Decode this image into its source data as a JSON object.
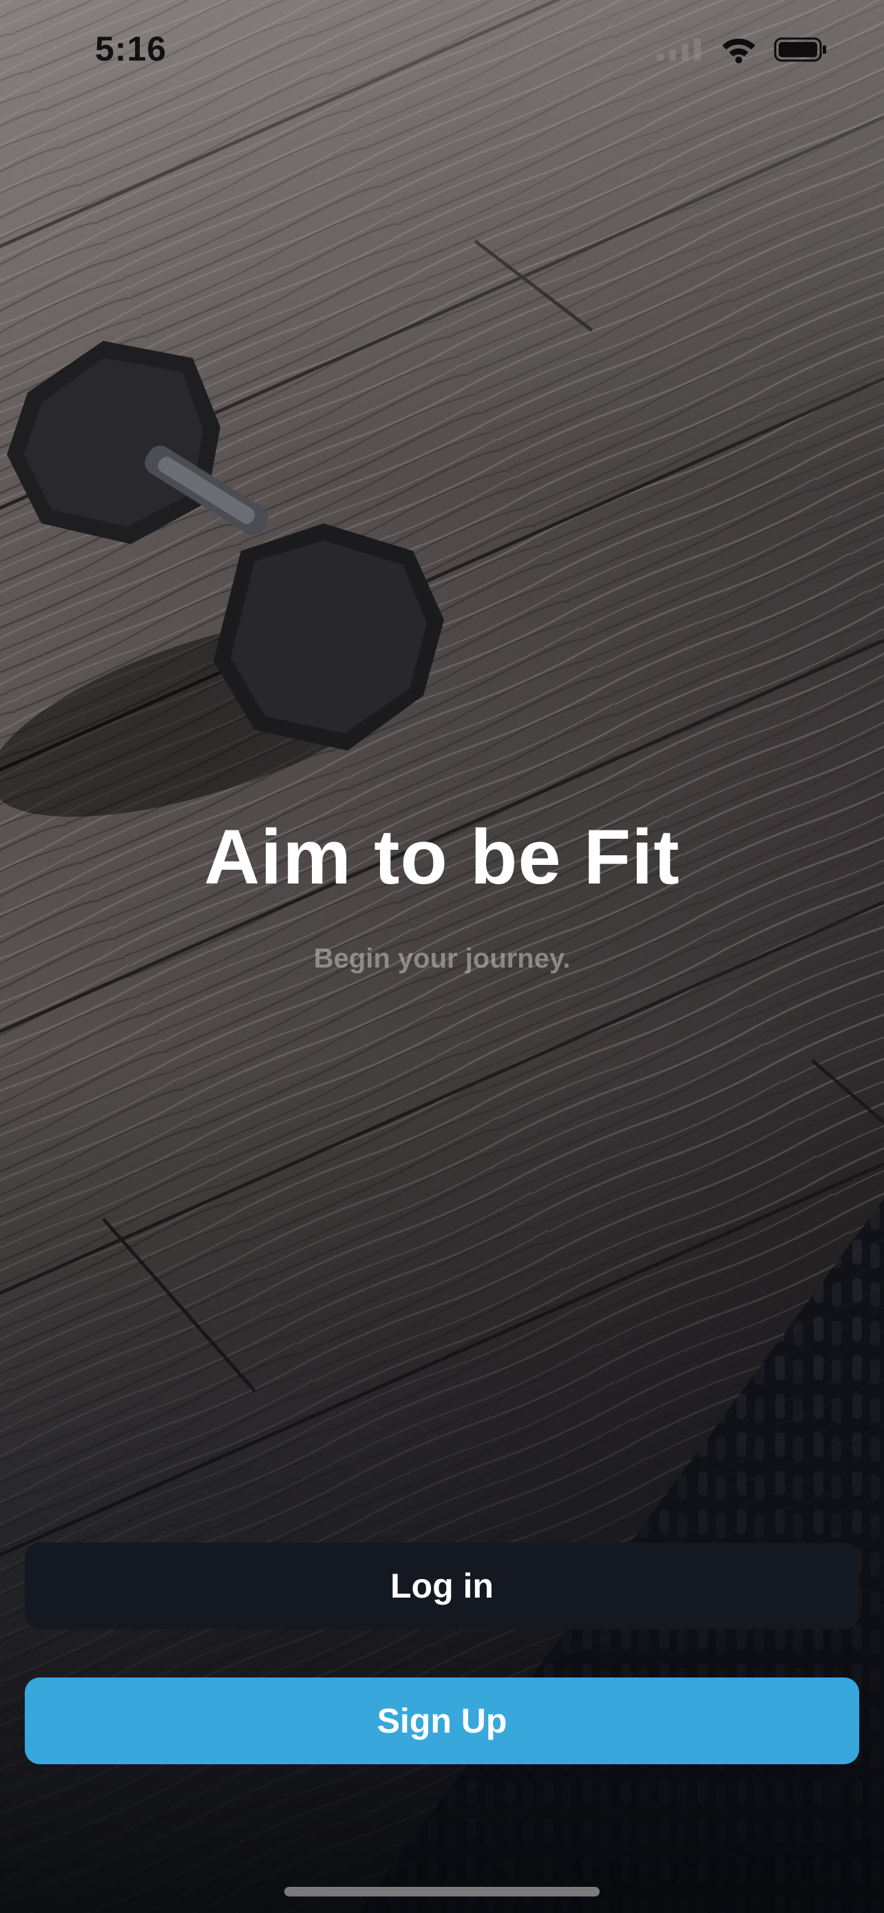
{
  "status_bar": {
    "time": "5:16",
    "icons": [
      "signal-icon",
      "wifi-icon",
      "battery-icon"
    ]
  },
  "hero": {
    "title": "Aim to be Fit",
    "subtitle": "Begin your journey."
  },
  "actions": {
    "login_label": "Log in",
    "signup_label": "Sign Up"
  },
  "colors": {
    "login_button": "#141820",
    "signup_button": "#38a8dc",
    "title_text": "#ffffff"
  }
}
